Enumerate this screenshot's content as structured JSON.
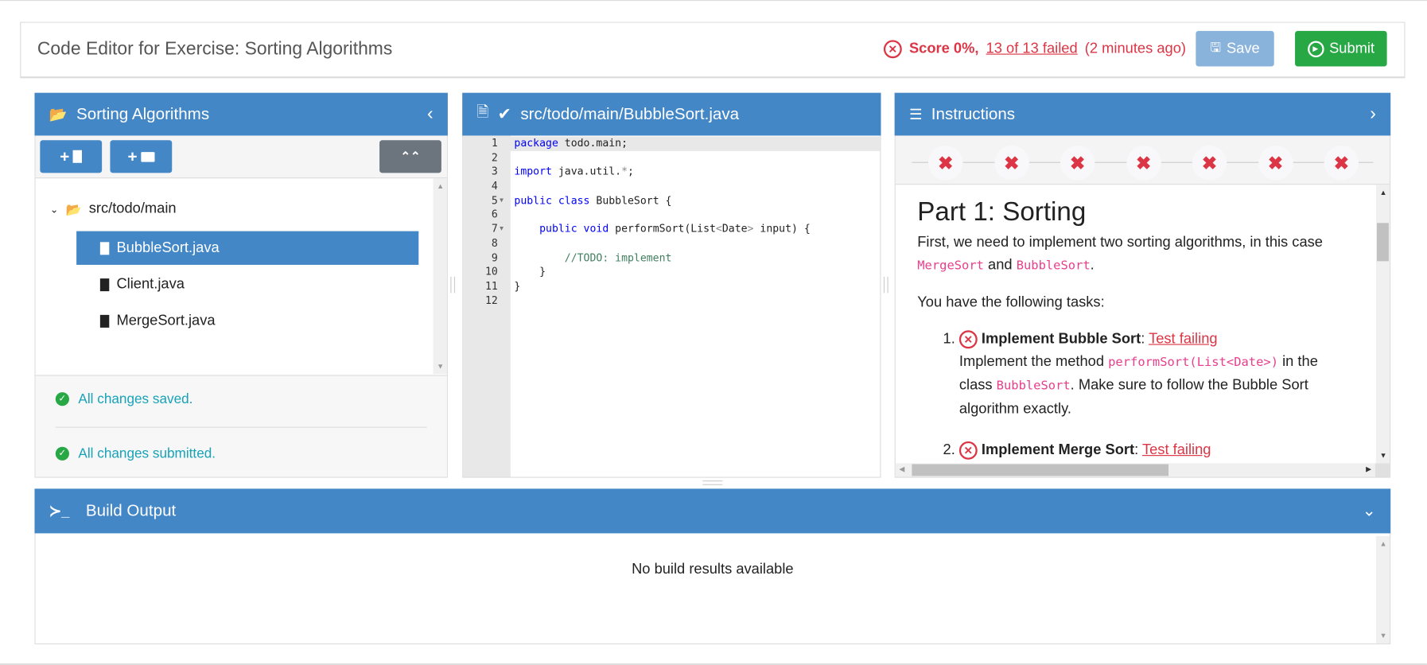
{
  "header": {
    "title": "Code Editor for Exercise: Sorting Algorithms",
    "score_label": "Score 0%,",
    "failed_link": "13 of 13 failed",
    "time_ago": "(2 minutes ago)",
    "save_label": "Save",
    "submit_label": "Submit"
  },
  "file_browser": {
    "title": "Sorting Algorithms",
    "folder": "src/todo/main",
    "files": [
      "BubbleSort.java",
      "Client.java",
      "MergeSort.java"
    ],
    "selected_file": "BubbleSort.java",
    "status_saved": "All changes saved.",
    "status_submitted": "All changes submitted."
  },
  "editor": {
    "file_path": "src/todo/main/BubbleSort.java",
    "line_numbers": [
      "1",
      "2",
      "3",
      "4",
      "5",
      "6",
      "7",
      "8",
      "9",
      "10",
      "11",
      "12"
    ]
  },
  "instructions": {
    "title": "Instructions",
    "step_count": 7,
    "heading": "Part 1: Sorting",
    "intro": "First, we need to implement two sorting algorithms, in this case",
    "intro_code1": "MergeSort",
    "intro_and": "and",
    "intro_code2": "BubbleSort",
    "tasks_intro": "You have the following tasks:",
    "tasks": [
      {
        "title": "Implement Bubble Sort",
        "status": "Test failing",
        "d1": "Implement the method",
        "code1": "performSort(List<Date>)",
        "d2": "in the class",
        "code2": "BubbleSort",
        "d3": ". Make sure to follow the Bubble Sort algorithm exactly."
      },
      {
        "title": "Implement Merge Sort",
        "status": "Test failing"
      }
    ]
  },
  "build_output": {
    "title": "Build Output",
    "empty_message": "No build results available"
  },
  "colors": {
    "primary": "#4487c7",
    "danger": "#dc3545",
    "success": "#28a745",
    "info": "#17a2b8"
  }
}
